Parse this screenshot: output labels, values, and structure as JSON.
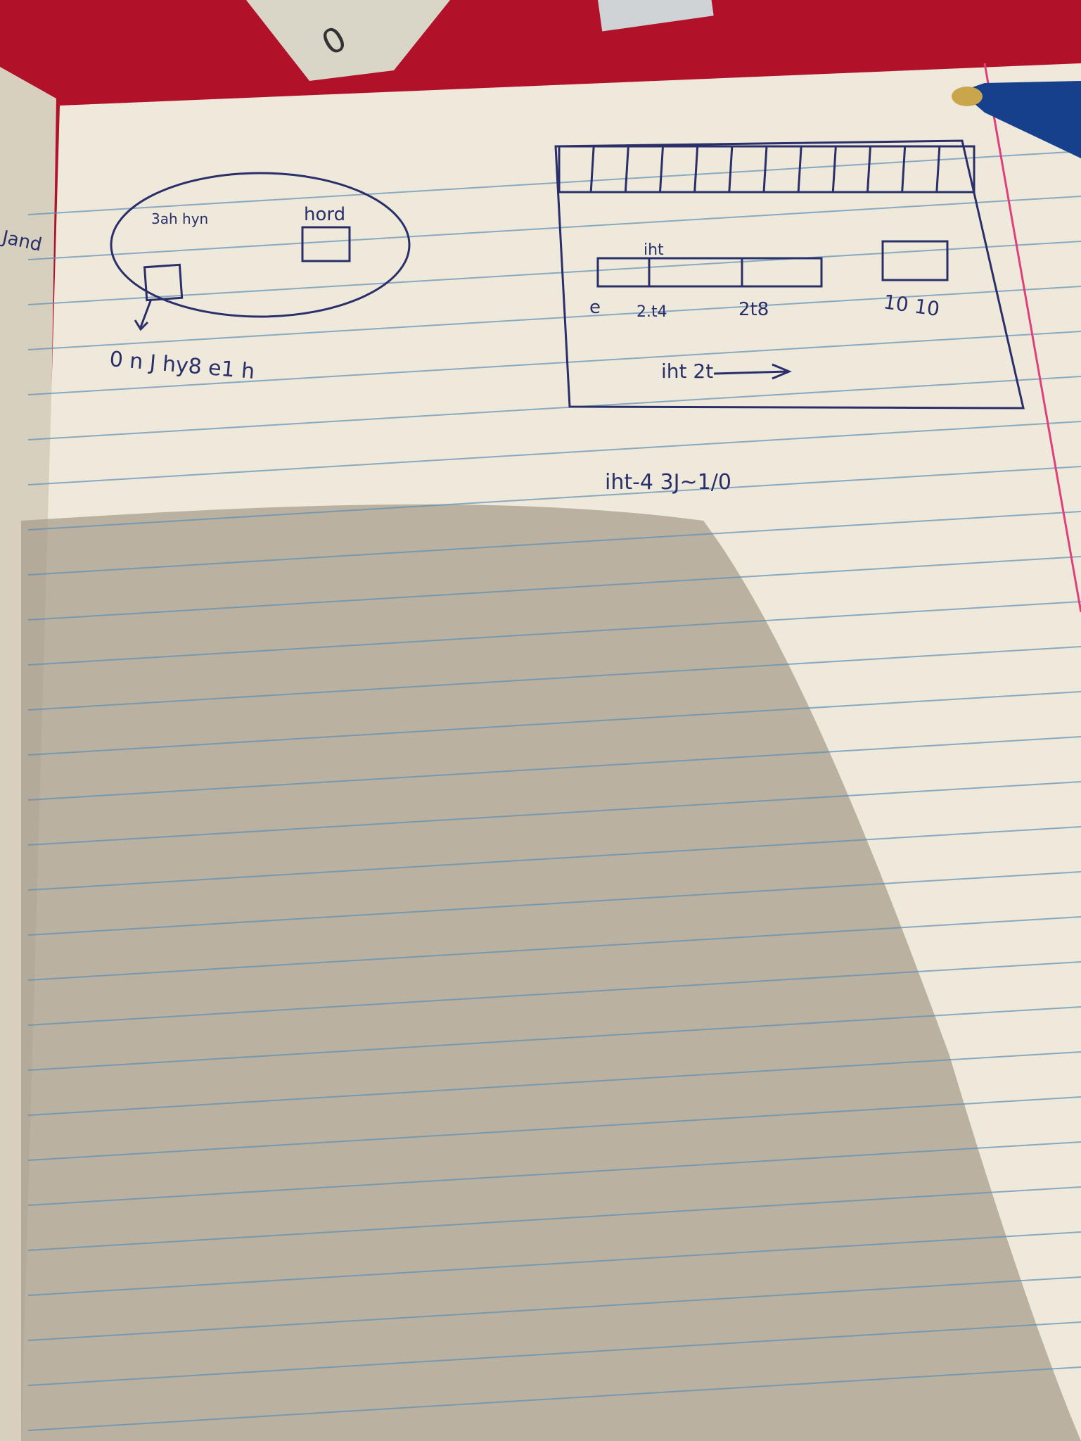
{
  "colors": {
    "background": "#b1122a",
    "paper": "#efe9dc",
    "rule_line": "#5d8fb3",
    "margin_line": "#e0407a",
    "ink": "#2a2f6a",
    "shadow": "#a89e8c"
  },
  "left_sketch": {
    "oval_label_left": "3ah hyn",
    "oval_label_right": "hord",
    "caption": "0 n J hy8 e1 h"
  },
  "right_sketch": {
    "bar_label": "iht",
    "tick_labels": [
      "e",
      "2.t4",
      "2t8"
    ],
    "box_label": "10 10",
    "arrow_label": "iht 2t",
    "grid_cell_count": 12
  },
  "note": "iht-4 3J~1/0",
  "margin_fragment": "Jand"
}
